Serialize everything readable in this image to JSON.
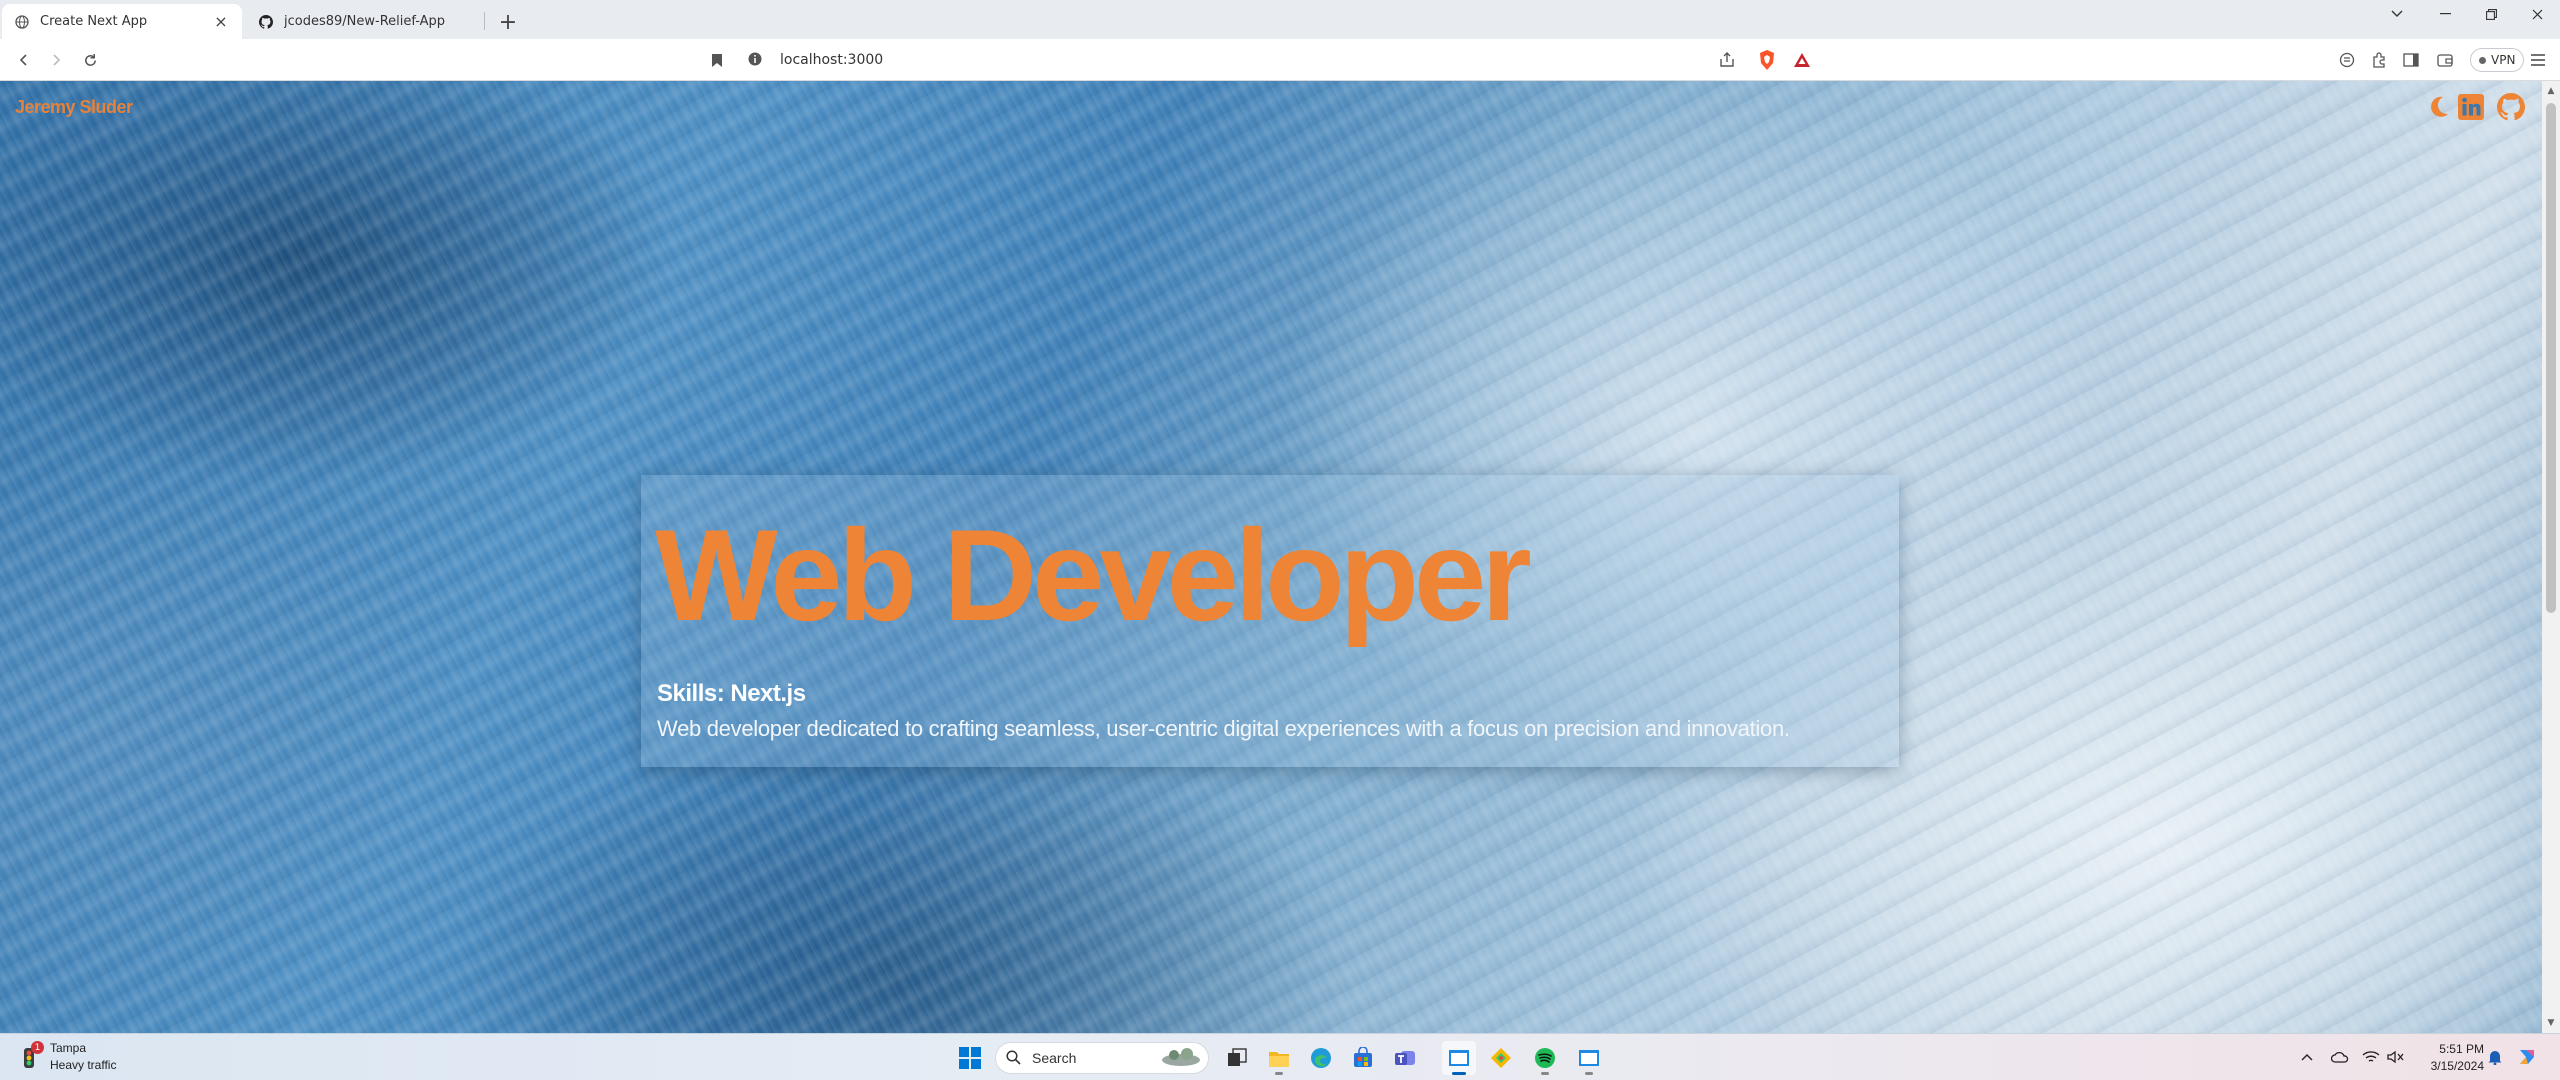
{
  "browser": {
    "tabs": [
      {
        "title": "Create Next App",
        "active": true
      },
      {
        "title": "jcodes89/New-Relief-App",
        "active": false
      }
    ],
    "address": "localhost:3000",
    "vpn_label": "VPN"
  },
  "page": {
    "brand": "Jeremy Sluder",
    "hero": {
      "title": "Web Developer",
      "skills": "Skills: Next.js",
      "description": "Web developer dedicated to crafting seamless, user-centric digital experiences with a focus on precision and innovation."
    },
    "nav_icons": [
      "moon-icon",
      "linkedin-icon",
      "github-icon"
    ],
    "accent_color": "#ee8436"
  },
  "taskbar": {
    "weather": {
      "location": "Tampa",
      "status": "Heavy traffic",
      "badge": "1"
    },
    "search_label": "Search",
    "clock": {
      "time": "5:51 PM",
      "date": "3/15/2024"
    }
  }
}
